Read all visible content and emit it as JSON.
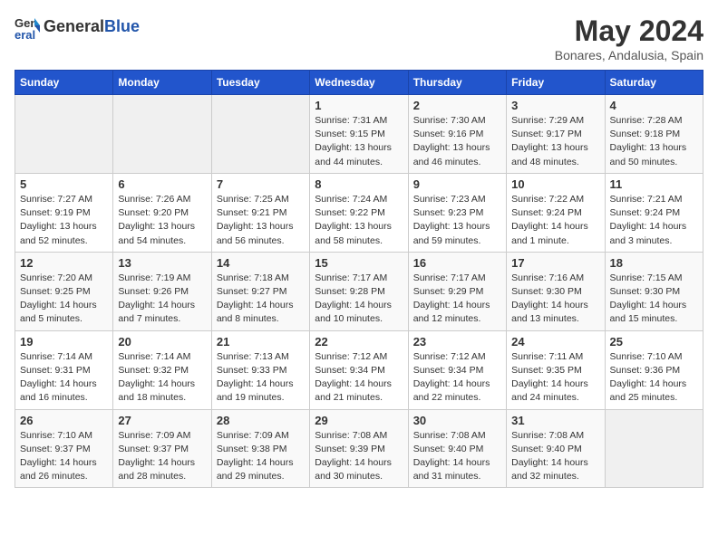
{
  "header": {
    "logo_general": "General",
    "logo_blue": "Blue",
    "title": "May 2024",
    "subtitle": "Bonares, Andalusia, Spain"
  },
  "calendar": {
    "weekdays": [
      "Sunday",
      "Monday",
      "Tuesday",
      "Wednesday",
      "Thursday",
      "Friday",
      "Saturday"
    ],
    "weeks": [
      [
        {
          "day": "",
          "info": ""
        },
        {
          "day": "",
          "info": ""
        },
        {
          "day": "",
          "info": ""
        },
        {
          "day": "1",
          "info": "Sunrise: 7:31 AM\nSunset: 9:15 PM\nDaylight: 13 hours\nand 44 minutes."
        },
        {
          "day": "2",
          "info": "Sunrise: 7:30 AM\nSunset: 9:16 PM\nDaylight: 13 hours\nand 46 minutes."
        },
        {
          "day": "3",
          "info": "Sunrise: 7:29 AM\nSunset: 9:17 PM\nDaylight: 13 hours\nand 48 minutes."
        },
        {
          "day": "4",
          "info": "Sunrise: 7:28 AM\nSunset: 9:18 PM\nDaylight: 13 hours\nand 50 minutes."
        }
      ],
      [
        {
          "day": "5",
          "info": "Sunrise: 7:27 AM\nSunset: 9:19 PM\nDaylight: 13 hours\nand 52 minutes."
        },
        {
          "day": "6",
          "info": "Sunrise: 7:26 AM\nSunset: 9:20 PM\nDaylight: 13 hours\nand 54 minutes."
        },
        {
          "day": "7",
          "info": "Sunrise: 7:25 AM\nSunset: 9:21 PM\nDaylight: 13 hours\nand 56 minutes."
        },
        {
          "day": "8",
          "info": "Sunrise: 7:24 AM\nSunset: 9:22 PM\nDaylight: 13 hours\nand 58 minutes."
        },
        {
          "day": "9",
          "info": "Sunrise: 7:23 AM\nSunset: 9:23 PM\nDaylight: 13 hours\nand 59 minutes."
        },
        {
          "day": "10",
          "info": "Sunrise: 7:22 AM\nSunset: 9:24 PM\nDaylight: 14 hours\nand 1 minute."
        },
        {
          "day": "11",
          "info": "Sunrise: 7:21 AM\nSunset: 9:24 PM\nDaylight: 14 hours\nand 3 minutes."
        }
      ],
      [
        {
          "day": "12",
          "info": "Sunrise: 7:20 AM\nSunset: 9:25 PM\nDaylight: 14 hours\nand 5 minutes."
        },
        {
          "day": "13",
          "info": "Sunrise: 7:19 AM\nSunset: 9:26 PM\nDaylight: 14 hours\nand 7 minutes."
        },
        {
          "day": "14",
          "info": "Sunrise: 7:18 AM\nSunset: 9:27 PM\nDaylight: 14 hours\nand 8 minutes."
        },
        {
          "day": "15",
          "info": "Sunrise: 7:17 AM\nSunset: 9:28 PM\nDaylight: 14 hours\nand 10 minutes."
        },
        {
          "day": "16",
          "info": "Sunrise: 7:17 AM\nSunset: 9:29 PM\nDaylight: 14 hours\nand 12 minutes."
        },
        {
          "day": "17",
          "info": "Sunrise: 7:16 AM\nSunset: 9:30 PM\nDaylight: 14 hours\nand 13 minutes."
        },
        {
          "day": "18",
          "info": "Sunrise: 7:15 AM\nSunset: 9:30 PM\nDaylight: 14 hours\nand 15 minutes."
        }
      ],
      [
        {
          "day": "19",
          "info": "Sunrise: 7:14 AM\nSunset: 9:31 PM\nDaylight: 14 hours\nand 16 minutes."
        },
        {
          "day": "20",
          "info": "Sunrise: 7:14 AM\nSunset: 9:32 PM\nDaylight: 14 hours\nand 18 minutes."
        },
        {
          "day": "21",
          "info": "Sunrise: 7:13 AM\nSunset: 9:33 PM\nDaylight: 14 hours\nand 19 minutes."
        },
        {
          "day": "22",
          "info": "Sunrise: 7:12 AM\nSunset: 9:34 PM\nDaylight: 14 hours\nand 21 minutes."
        },
        {
          "day": "23",
          "info": "Sunrise: 7:12 AM\nSunset: 9:34 PM\nDaylight: 14 hours\nand 22 minutes."
        },
        {
          "day": "24",
          "info": "Sunrise: 7:11 AM\nSunset: 9:35 PM\nDaylight: 14 hours\nand 24 minutes."
        },
        {
          "day": "25",
          "info": "Sunrise: 7:10 AM\nSunset: 9:36 PM\nDaylight: 14 hours\nand 25 minutes."
        }
      ],
      [
        {
          "day": "26",
          "info": "Sunrise: 7:10 AM\nSunset: 9:37 PM\nDaylight: 14 hours\nand 26 minutes."
        },
        {
          "day": "27",
          "info": "Sunrise: 7:09 AM\nSunset: 9:37 PM\nDaylight: 14 hours\nand 28 minutes."
        },
        {
          "day": "28",
          "info": "Sunrise: 7:09 AM\nSunset: 9:38 PM\nDaylight: 14 hours\nand 29 minutes."
        },
        {
          "day": "29",
          "info": "Sunrise: 7:08 AM\nSunset: 9:39 PM\nDaylight: 14 hours\nand 30 minutes."
        },
        {
          "day": "30",
          "info": "Sunrise: 7:08 AM\nSunset: 9:40 PM\nDaylight: 14 hours\nand 31 minutes."
        },
        {
          "day": "31",
          "info": "Sunrise: 7:08 AM\nSunset: 9:40 PM\nDaylight: 14 hours\nand 32 minutes."
        },
        {
          "day": "",
          "info": ""
        }
      ]
    ]
  }
}
